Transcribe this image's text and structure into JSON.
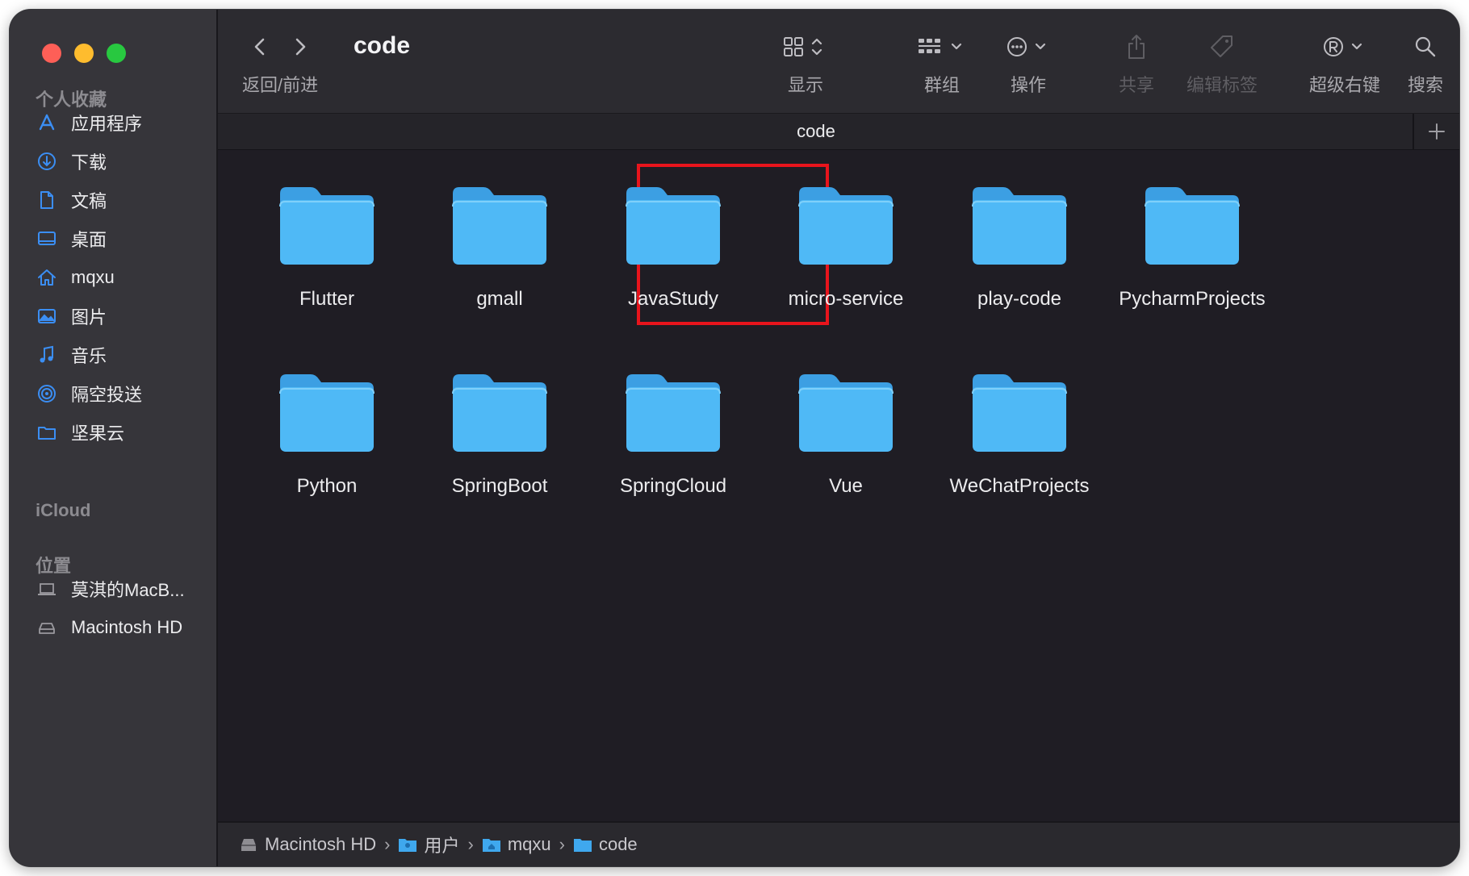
{
  "window": {
    "title": "code",
    "traffic_lights": {
      "close": "#fe5f57",
      "minimize": "#febc2e",
      "zoom": "#28c840"
    }
  },
  "toolbar": {
    "nav_label": "返回/前进",
    "view_label": "显示",
    "group_label": "群组",
    "action_label": "操作",
    "share_label": "共享",
    "tags_label": "编辑标签",
    "super_right_label": "超级右键",
    "search_label": "搜索"
  },
  "tab": {
    "title": "code",
    "add_icon": "plus-icon"
  },
  "sidebar": {
    "favorites_header": "个人收藏",
    "favorites": [
      {
        "label": "应用程序",
        "icon": "applications-icon"
      },
      {
        "label": "下载",
        "icon": "downloads-icon"
      },
      {
        "label": "文稿",
        "icon": "documents-icon"
      },
      {
        "label": "桌面",
        "icon": "desktop-icon"
      },
      {
        "label": "mqxu",
        "icon": "home-icon"
      },
      {
        "label": "图片",
        "icon": "pictures-icon"
      },
      {
        "label": "音乐",
        "icon": "music-icon"
      },
      {
        "label": "隔空投送",
        "icon": "airdrop-icon"
      },
      {
        "label": "坚果云",
        "icon": "folder-icon"
      }
    ],
    "icloud_header": "iCloud",
    "locations_header": "位置",
    "locations": [
      {
        "label": "莫淇的MacB...",
        "icon": "laptop-icon"
      },
      {
        "label": "Macintosh HD",
        "icon": "disk-icon"
      }
    ]
  },
  "folders": [
    {
      "name": "Flutter"
    },
    {
      "name": "gmall"
    },
    {
      "name": "JavaStudy",
      "highlighted": true
    },
    {
      "name": "micro-service"
    },
    {
      "name": "play-code"
    },
    {
      "name": "PycharmProjects"
    },
    {
      "name": "Python"
    },
    {
      "name": "SpringBoot"
    },
    {
      "name": "SpringCloud"
    },
    {
      "name": "Vue"
    },
    {
      "name": "WeChatProjects"
    }
  ],
  "path": [
    {
      "label": "Macintosh HD",
      "icon": "disk-icon"
    },
    {
      "label": "用户",
      "icon": "users-folder-icon"
    },
    {
      "label": "mqxu",
      "icon": "home-folder-icon"
    },
    {
      "label": "code",
      "icon": "folder-icon"
    }
  ],
  "colors": {
    "accent": "#3b8ef3",
    "folder": "#4cb6f5",
    "highlight": "#e8141c"
  }
}
